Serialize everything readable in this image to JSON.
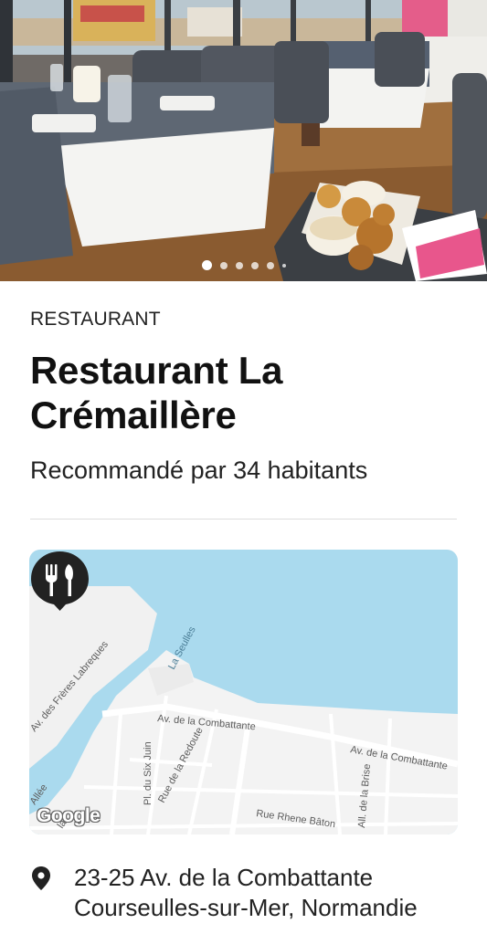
{
  "hero": {
    "image": "restaurant-interior-photo",
    "carousel": {
      "total_dots": 6,
      "active_index": 0
    }
  },
  "place": {
    "category": "RESTAURANT",
    "name": "Restaurant La Crémaillère",
    "recommendation": "Recommandé par 34 habitants"
  },
  "map": {
    "streets": {
      "freres": "Av. des Frères Labreques",
      "seulles": "La Seulles",
      "combattante_1": "Av. de la Combattante",
      "combattante_2": "Av. de la Combattante",
      "six_juin": "Pl. du Six Juin",
      "redoute": "Rue de la Redoute",
      "rhene": "Rue Rhene Bâton",
      "brise": "All. de la Brise",
      "allee": "Allée",
      "la": "la"
    },
    "attribution": "Google",
    "pin_icon": "fork-knife-icon",
    "colors": {
      "water": "#aadaee",
      "land": "#f3f3f3",
      "pin": "#222222"
    }
  },
  "address": {
    "icon": "location-pin-icon",
    "line1": "23-25 Av. de la Combattante",
    "line2": "Courseulles-sur-Mer, Normandie"
  }
}
